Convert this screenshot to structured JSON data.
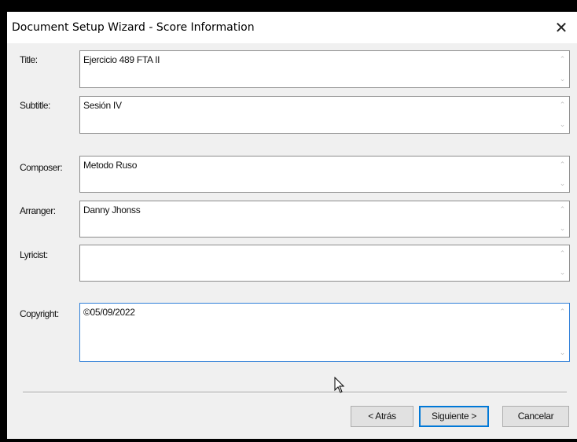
{
  "window": {
    "title": "Document Setup Wizard - Score Information",
    "close_glyph": "✕"
  },
  "fields": [
    {
      "label": "Title:",
      "value": "Ejercicio 489 FTA II"
    },
    {
      "label": "Subtitle:",
      "value": "Sesión IV"
    },
    {
      "label": "Composer:",
      "value": "Metodo Ruso"
    },
    {
      "label": "Arranger:",
      "value": "Danny Jhonss"
    },
    {
      "label": "Lyricist:",
      "value": ""
    },
    {
      "label": "Copyright:",
      "value": "©05/09/2022"
    }
  ],
  "scroll": {
    "up_glyph": "⌃",
    "down_glyph": "⌄"
  },
  "buttons": {
    "back": "< Atrás",
    "next": "Siguiente >",
    "cancel": "Cancelar"
  },
  "colors": {
    "focus_border": "#2f7fd8",
    "default_button_border": "#0078d7"
  },
  "icons": {
    "cursor": "mouse-pointer-icon"
  }
}
